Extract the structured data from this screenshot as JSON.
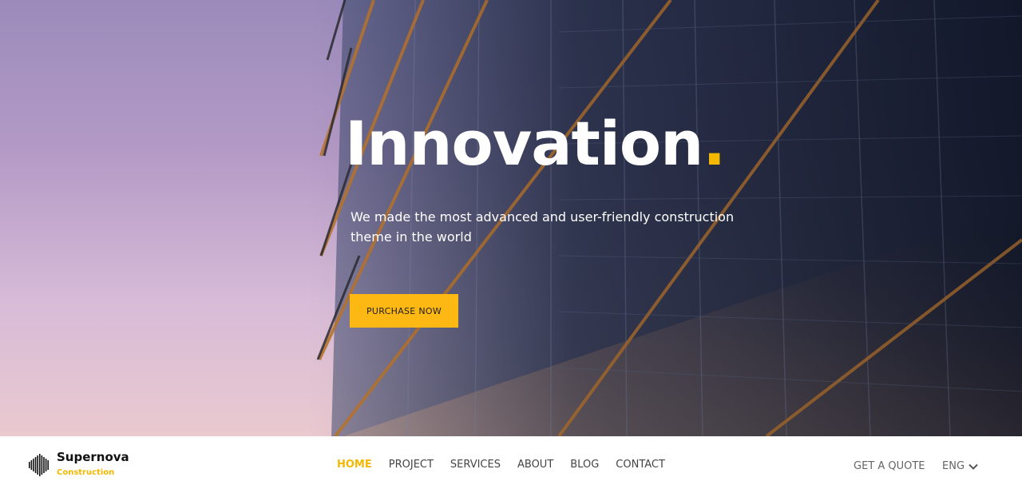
{
  "hero": {
    "title": "Innovation",
    "title_dot": ".",
    "subtitle": "We made the most advanced and user-friendly construction theme in the world",
    "cta_label": "PURCHASE NOW"
  },
  "brand": {
    "name": "Supernova",
    "tagline": "Construction",
    "icon": "sound-wave-logo-icon"
  },
  "nav": {
    "items": [
      {
        "label": "HOME",
        "active": true
      },
      {
        "label": "PROJECT",
        "active": false
      },
      {
        "label": "SERVICES",
        "active": false
      },
      {
        "label": "ABOUT",
        "active": false
      },
      {
        "label": "BLOG",
        "active": false
      },
      {
        "label": "CONTACT",
        "active": false
      }
    ],
    "quote_label": "GET A QUOTE",
    "language": "ENG",
    "language_icon": "chevron-down-icon"
  },
  "colors": {
    "accent": "#f5b800",
    "button": "#fdb813",
    "text_dark": "#111111",
    "nav_text": "#444444"
  }
}
